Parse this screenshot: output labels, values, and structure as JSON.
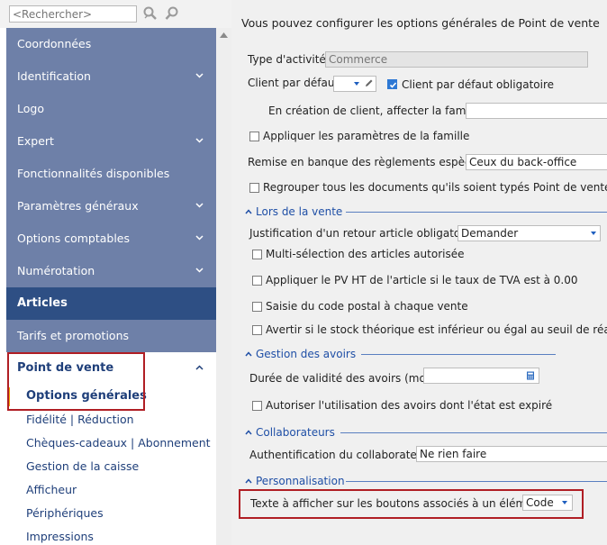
{
  "search": {
    "placeholder": "<Rechercher>"
  },
  "sidebar": {
    "items": [
      {
        "label": "Coordonnées",
        "chevron": false
      },
      {
        "label": "Identification",
        "chevron": true
      },
      {
        "label": "Logo",
        "chevron": false
      },
      {
        "label": "Expert",
        "chevron": true
      },
      {
        "label": "Fonctionnalités disponibles",
        "chevron": false
      },
      {
        "label": "Paramètres généraux",
        "chevron": true
      },
      {
        "label": "Options comptables",
        "chevron": true
      },
      {
        "label": "Numérotation",
        "chevron": true
      },
      {
        "label": "Articles",
        "chevron": false,
        "selected": true
      },
      {
        "label": "Tarifs et promotions",
        "chevron": false
      }
    ],
    "open_section": {
      "label": "Point de vente",
      "icon": "chevron-up-icon"
    },
    "sub_items": [
      {
        "label": "Options générales",
        "current": true
      },
      {
        "label": "Fidélité | Réduction"
      },
      {
        "label": "Chèques-cadeaux | Abonnement"
      },
      {
        "label": "Gestion de la caisse"
      },
      {
        "label": "Afficheur"
      },
      {
        "label": "Périphériques"
      },
      {
        "label": "Impressions"
      }
    ]
  },
  "main": {
    "intro": "Vous pouvez configurer les options générales de Point de vente",
    "activity_type": {
      "label": "Type d'activité",
      "value": "Commerce"
    },
    "default_client": {
      "label": "Client par défaut",
      "value": "",
      "mandatory_label": "Client par défaut obligatoire",
      "mandatory_checked": true
    },
    "family_on_create": {
      "label": "En création de client, affecter la famille",
      "value": ""
    },
    "apply_family_params": {
      "label": "Appliquer les paramètres de la famille",
      "checked": false
    },
    "cash_deposit": {
      "label": "Remise en banque des règlements espèces",
      "value": "Ceux du back-office"
    },
    "group_documents": {
      "label": "Regrouper tous les documents qu'ils soient typés Point de vente ou n",
      "checked": false
    },
    "section_return": {
      "title": "Lors de la vente",
      "justification": {
        "label": "Justification d'un retour article obligatoire",
        "value": "Demander"
      },
      "multi_select": {
        "label": "Multi-sélection des articles autorisée",
        "checked": false
      },
      "apply_pv_ht": {
        "label": "Appliquer le PV HT de l'article si le taux de TVA est à 0.00",
        "checked": false
      },
      "postal_code": {
        "label": "Saisie du code postal à chaque vente",
        "checked": false
      },
      "stock_warning": {
        "label": "Avertir si le stock théorique est inférieur ou égal au seuil de réapprovi",
        "checked": false
      }
    },
    "section_credits": {
      "title": "Gestion des avoirs",
      "validity": {
        "label": "Durée de validité des avoirs (mois)",
        "value": ""
      },
      "expired": {
        "label": "Autoriser l'utilisation des avoirs dont l'état est expiré",
        "checked": false
      }
    },
    "section_staff": {
      "title": "Collaborateurs",
      "auth": {
        "label": "Authentification du collaborateur",
        "value": "Ne rien faire"
      }
    },
    "section_custom": {
      "title": "Personnalisation",
      "button_text": {
        "label": "Texte à afficher sur les boutons associés à un élément",
        "value": "Code"
      }
    }
  },
  "colors": {
    "sidebar_item": "#6e80a8",
    "sidebar_selected": "#2e4f84",
    "highlight_border": "#b01e24",
    "section_blue": "#1f4fa6",
    "current_marker": "#f0a000"
  }
}
